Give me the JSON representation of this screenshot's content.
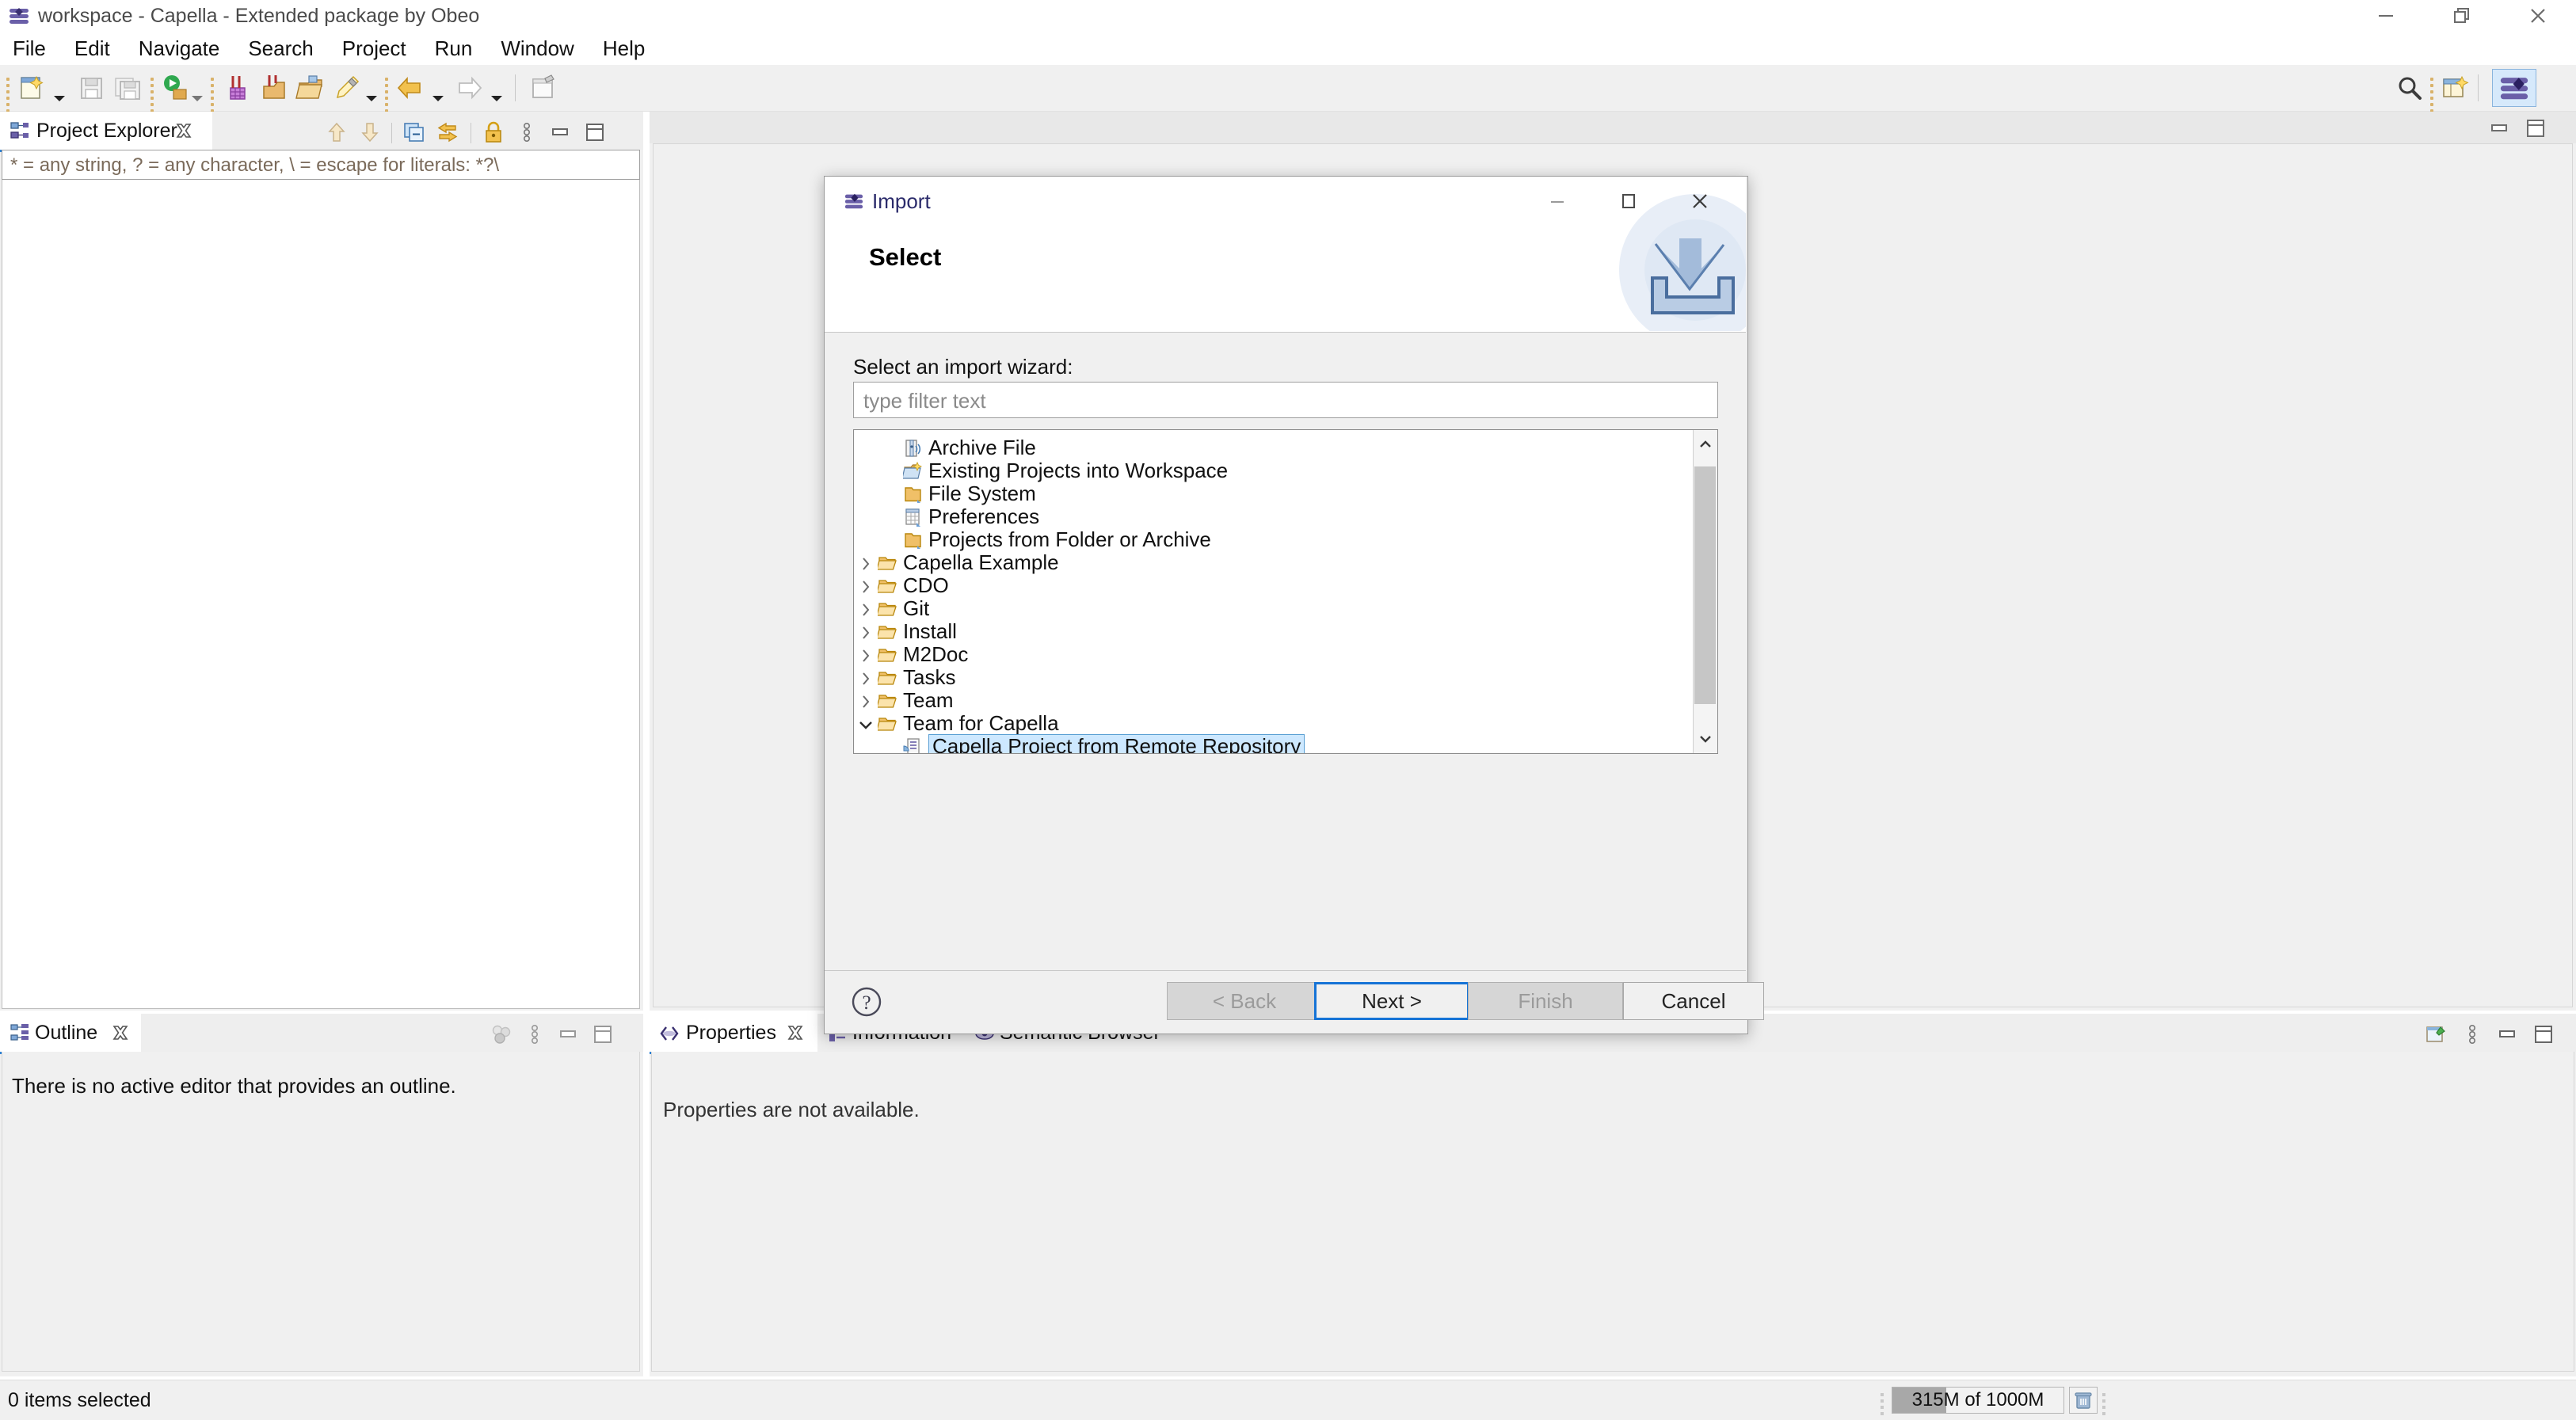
{
  "window": {
    "title": "workspace - Capella - Extended package by Obeo",
    "app_icon": "capella-logo-icon",
    "controls": {
      "minimize": "minimize-icon",
      "restore": "restore-icon",
      "close": "close-icon"
    }
  },
  "menubar": {
    "items": [
      "File",
      "Edit",
      "Navigate",
      "Search",
      "Project",
      "Run",
      "Window",
      "Help"
    ]
  },
  "toolbar": {
    "items": [
      {
        "name": "new-wizard-icon"
      },
      {
        "name": "new-dropdown-arrow"
      },
      {
        "name": "save-icon"
      },
      {
        "name": "save-all-icon"
      },
      {
        "name": "run-icon"
      },
      {
        "name": "run-dropdown-arrow"
      },
      {
        "name": "capella-validate-icon"
      },
      {
        "name": "capella-transition-icon"
      },
      {
        "name": "capella-open-model-icon"
      },
      {
        "name": "highlight-icon"
      },
      {
        "name": "highlight-dropdown-arrow"
      },
      {
        "name": "back-icon"
      },
      {
        "name": "back-dropdown-arrow"
      },
      {
        "name": "forward-icon"
      },
      {
        "name": "forward-dropdown-arrow"
      },
      {
        "name": "new-editor-icon"
      }
    ],
    "right_items": [
      {
        "name": "search-icon"
      },
      {
        "name": "open-perspective-icon"
      },
      {
        "name": "capella-perspective-icon"
      }
    ]
  },
  "project_explorer": {
    "tab_label": "Project Explorer",
    "tab_icon": "project-explorer-icon",
    "close_icon": "close-tab-icon",
    "filter_hint": "* = any string, ? = any character, \\ = escape for literals: *?\\",
    "toolbar_icons": [
      "collapse-up-icon",
      "expand-down-icon",
      "collapse-all-icon",
      "link-with-editor-icon",
      "lock-icon",
      "view-menu-icon",
      "minimize-icon",
      "maximize-icon"
    ]
  },
  "editor_area": {
    "toolbar_icons": [
      "minimize-icon",
      "maximize-icon"
    ]
  },
  "outline": {
    "tab_label": "Outline",
    "tab_icon": "outline-icon",
    "close_icon": "close-tab-icon",
    "message": "There is no active editor that provides an outline.",
    "toolbar_icons": [
      "filters-icon",
      "view-menu-icon",
      "minimize-icon",
      "maximize-icon"
    ]
  },
  "properties": {
    "tabs": [
      {
        "label": "Properties",
        "icon": "properties-icon",
        "active": true,
        "closable": true
      },
      {
        "label": "Information",
        "icon": "information-icon",
        "active": false,
        "closable": false
      },
      {
        "label": "Semantic Browser",
        "icon": "semantic-browser-icon",
        "active": false,
        "closable": false
      }
    ],
    "message": "Properties are not available.",
    "toolbar_icons": [
      "pin-icon",
      "view-menu-icon",
      "minimize-icon",
      "maximize-icon"
    ]
  },
  "statusbar": {
    "selection_text": "0 items selected",
    "heap_label": "315M of 1000M",
    "heap_percent": 31.5,
    "trash_icon": "trash-icon"
  },
  "dialog": {
    "title": "Import",
    "title_icon": "capella-logo-icon",
    "heading": "Select",
    "banner_icon": "import-banner-icon",
    "prompt": "Select an import wizard:",
    "filter_placeholder": "type filter text",
    "controls": {
      "minimize": "minimize-icon",
      "maximize": "maximize-icon",
      "close": "close-icon"
    },
    "tree": [
      {
        "label": "Archive File",
        "indent": 1,
        "icon": "archive-file-icon",
        "twisty": "none",
        "selected": false
      },
      {
        "label": "Existing Projects into Workspace",
        "indent": 1,
        "icon": "import-project-icon",
        "twisty": "none",
        "selected": false
      },
      {
        "label": "File System",
        "indent": 1,
        "icon": "folder-plain-icon",
        "twisty": "none",
        "selected": false
      },
      {
        "label": "Preferences",
        "indent": 1,
        "icon": "preferences-icon",
        "twisty": "none",
        "selected": false
      },
      {
        "label": "Projects from Folder or Archive",
        "indent": 1,
        "icon": "folder-plain-icon",
        "twisty": "none",
        "selected": false
      },
      {
        "label": "Capella Example",
        "indent": 0,
        "icon": "folder-open-icon",
        "twisty": "collapsed",
        "selected": false
      },
      {
        "label": "CDO",
        "indent": 0,
        "icon": "folder-open-icon",
        "twisty": "collapsed",
        "selected": false
      },
      {
        "label": "Git",
        "indent": 0,
        "icon": "folder-open-icon",
        "twisty": "collapsed",
        "selected": false
      },
      {
        "label": "Install",
        "indent": 0,
        "icon": "folder-open-icon",
        "twisty": "collapsed",
        "selected": false
      },
      {
        "label": "M2Doc",
        "indent": 0,
        "icon": "folder-open-icon",
        "twisty": "collapsed",
        "selected": false
      },
      {
        "label": "Tasks",
        "indent": 0,
        "icon": "folder-open-icon",
        "twisty": "collapsed",
        "selected": false
      },
      {
        "label": "Team",
        "indent": 0,
        "icon": "folder-open-icon",
        "twisty": "collapsed",
        "selected": false
      },
      {
        "label": "Team for Capella",
        "indent": 0,
        "icon": "folder-open-icon",
        "twisty": "expanded",
        "selected": false
      },
      {
        "label": "Capella Project from Remote Repository",
        "indent": 1,
        "icon": "remote-project-icon",
        "twisty": "none",
        "selected": true
      }
    ],
    "buttons": {
      "help": "help-icon",
      "back": "< Back",
      "next": "Next >",
      "finish": "Finish",
      "cancel": "Cancel",
      "back_enabled": false,
      "next_enabled": true,
      "finish_enabled": false,
      "cancel_enabled": true,
      "default_button": "Next >"
    }
  },
  "colors": {
    "accent": "#1573d6",
    "selection": "#cde8ff",
    "capella_purple": "#6a5fa8",
    "folder": "#e8b765",
    "panel": "#f0f0f0"
  }
}
